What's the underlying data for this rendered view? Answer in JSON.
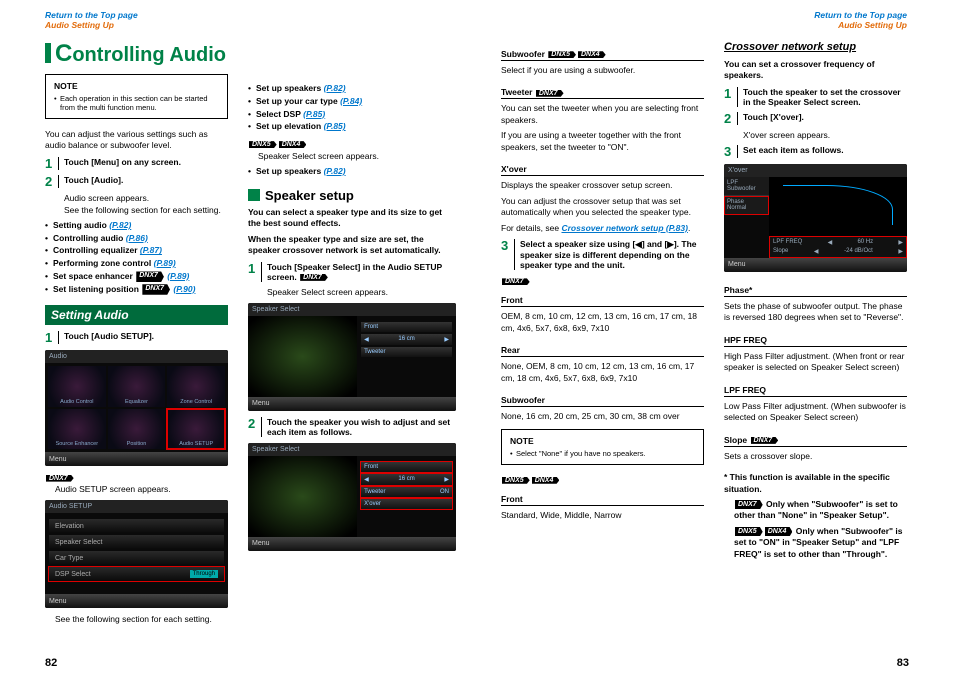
{
  "header": {
    "return_link": "Return to the Top page",
    "breadcrumb": "Audio Setting Up"
  },
  "col1": {
    "title_cap": "C",
    "title_rest": "ontrolling Audio",
    "note_title": "NOTE",
    "note_body": "Each operation in this section can be started from the multi function menu.",
    "intro": "You can adjust the various settings such as audio balance or subwoofer level.",
    "step1": "Touch [Menu] on any screen.",
    "step2": "Touch [Audio].",
    "step2_sub1": "Audio screen appears.",
    "step2_sub2": "See the following section for each setting.",
    "links": [
      {
        "t": "Setting audio",
        "p": "(P.82)"
      },
      {
        "t": "Controlling audio",
        "p": "(P.86)"
      },
      {
        "t": "Controlling equalizer",
        "p": "(P.87)"
      },
      {
        "t": "Performing zone control",
        "p": "(P.89)"
      },
      {
        "t": "Set space enhancer",
        "badge": "DNX7",
        "p": "(P.89)"
      },
      {
        "t": "Set listening position",
        "badge": "DNX7",
        "p": "(P.90)"
      }
    ],
    "setting_hdr": "Setting Audio",
    "sa_step1": "Touch [Audio SETUP].",
    "shot1": {
      "top": "Audio",
      "tiles": [
        "Audio Control",
        "Equalizer",
        "Zone Control",
        "Source Enhancer",
        "Position",
        "Audio SETUP"
      ],
      "menu": "Menu"
    },
    "badge7": "DNX7",
    "sa_sub": "Audio SETUP screen appears.",
    "shot2": {
      "top": "Audio SETUP",
      "rows": [
        "Elevation",
        "Speaker Select",
        "Car Type",
        "DSP Select"
      ],
      "menu": "Menu",
      "through": "Through"
    },
    "sa_foot": "See the following section for each setting."
  },
  "col2": {
    "links": [
      {
        "t": "Set up speakers",
        "p": "(P.82)"
      },
      {
        "t": "Set up your car type",
        "p": "(P.84)"
      },
      {
        "t": "Select DSP",
        "p": "(P.85)"
      },
      {
        "t": "Set up elevation",
        "p": "(P.85)"
      }
    ],
    "badge5": "DNX5",
    "badge4": "DNX4",
    "b54_sub": "Speaker Select screen appears.",
    "b54_link_t": "Set up speakers",
    "b54_link_p": "(P.82)",
    "spk_hdr": "Speaker setup",
    "spk_intro": "You can select a speaker type and its size to get the best sound effects.",
    "spk_intro2": "When the speaker type and size are set, the speaker crossover network is set automatically.",
    "spk_step1": "Touch [Speaker Select] in the Audio SETUP screen.",
    "badge7": "DNX7",
    "spk_step1_sub": "Speaker Select screen appears.",
    "shot3": {
      "top": "Speaker Select",
      "front": "Front",
      "size": "16 cm",
      "tweeter": "Tweeter",
      "menu": "Menu"
    },
    "spk_step2": "Touch the speaker you wish to adjust and set each item as follows.",
    "shot4": {
      "top": "Speaker Select",
      "front": "Front",
      "size": "16 cm",
      "tweeter": "Tweeter",
      "on": "ON",
      "xover": "X'over",
      "menu": "Menu"
    }
  },
  "col3": {
    "sub_hdr": "Subwoofer",
    "badge5": "DNX5",
    "badge4": "DNX4",
    "sub_txt": "Select if you are using a subwoofer.",
    "tw_hdr": "Tweeter",
    "badge7": "DNX7",
    "tw_txt1": "You can set the tweeter when you are selecting front speakers.",
    "tw_txt2": "If you are using a tweeter together with the front speakers, set the tweeter to \"ON\".",
    "xo_hdr": "X'over",
    "xo_txt1": "Displays the speaker crossover setup screen.",
    "xo_txt2": "You can adjust the crossover setup that was set automatically when you selected the speaker type.",
    "xo_txt3_a": "For details, see ",
    "xo_txt3_link": "Crossover network setup (P.83)",
    "step3": "Select a speaker size using [◀] and [▶]. The speaker size is different depending on the speaker type and the unit.",
    "d7_front_hdr": "Front",
    "d7_front_txt": "OEM, 8 cm, 10 cm, 12 cm, 13 cm, 16 cm, 17 cm, 18 cm, 4x6, 5x7, 6x8, 6x9, 7x10",
    "d7_rear_hdr": "Rear",
    "d7_rear_txt": "None, OEM, 8 cm, 10 cm, 12 cm, 13 cm, 16 cm, 17 cm, 18 cm, 4x6, 5x7, 6x8, 6x9, 7x10",
    "d7_sub_hdr": "Subwoofer",
    "d7_sub_txt": "None, 16 cm, 20 cm, 25 cm, 30 cm, 38 cm over",
    "note2_ttl": "NOTE",
    "note2_body": "Select \"None\" if you have no speakers.",
    "d54_front_hdr": "Front",
    "d54_front_txt": "Standard, Wide, Middle, Narrow"
  },
  "col4": {
    "cn_hdr": "Crossover network setup",
    "cn_intro": "You can set a crossover frequency of speakers.",
    "cn_step1": "Touch the speaker to set the crossover in the Speaker Select screen.",
    "cn_step2": "Touch [X'over].",
    "cn_step2_sub": "X'over screen appears.",
    "cn_step3": "Set each item as follows.",
    "shot5": {
      "top": "X'over",
      "lpf": "LPF Subwoofer",
      "phase": "Phase",
      "normal": "Normal",
      "lpffreq": "LPF FREQ",
      "lpfval": "60 Hz",
      "slope": "Slope",
      "slopeval": "-24 dB/Oct",
      "menu": "Menu"
    },
    "ph_hdr": "Phase*",
    "ph_txt": "Sets the phase of subwoofer output. The phase is reversed 180 degrees when set to \"Reverse\".",
    "hpf_hdr": "HPF FREQ",
    "hpf_txt": "High Pass Filter adjustment. (When front or rear speaker is selected on Speaker Select screen)",
    "lpf_hdr": "LPF FREQ",
    "lpf_txt": "Low Pass Filter adjustment. (When subwoofer is selected on Speaker Select screen)",
    "sl_hdr": "Slope",
    "badge7": "DNX7",
    "sl_txt": "Sets a crossover slope.",
    "foot1": "* This function is available in the specific situation.",
    "foot2a": " Only when \"Subwoofer\" is set to other than \"None\" in \"Speaker Setup\".",
    "foot3a": " Only when \"Subwoofer\" is set to \"ON\" in \"Speaker Setup\" and \"LPF FREQ\" is set to other than \"Through\".",
    "badge5": "DNX5",
    "badge4": "DNX4"
  },
  "pagenums": {
    "left": "82",
    "right": "83"
  }
}
